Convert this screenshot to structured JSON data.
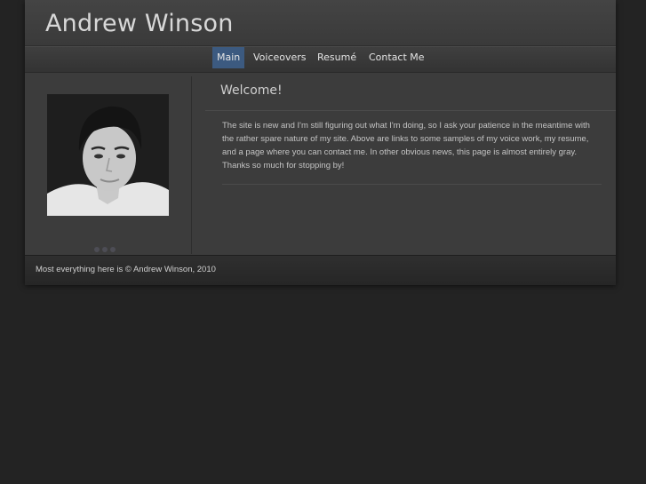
{
  "header": {
    "title": "Andrew Winson"
  },
  "nav": {
    "items": [
      {
        "label": "Main",
        "active": true
      },
      {
        "label": "Voiceovers",
        "active": false
      },
      {
        "label": "Resumé",
        "active": false
      },
      {
        "label": "Contact Me",
        "active": false
      }
    ]
  },
  "main": {
    "heading": "Welcome!",
    "body": "The site is new and I'm still figuring out what I'm doing, so I ask your patience in the meantime with the rather spare nature of my site.  Above are links to some samples of my voice work, my resume, and a page where you can contact me.  In other obvious news, this page is almost entirely gray.  Thanks so much for stopping by!"
  },
  "footer": {
    "text": "Most everything here is © Andrew Winson, 2010"
  },
  "colors": {
    "accent": "#3c5a80",
    "background": "#232323",
    "panel": "#3c3c3c"
  }
}
